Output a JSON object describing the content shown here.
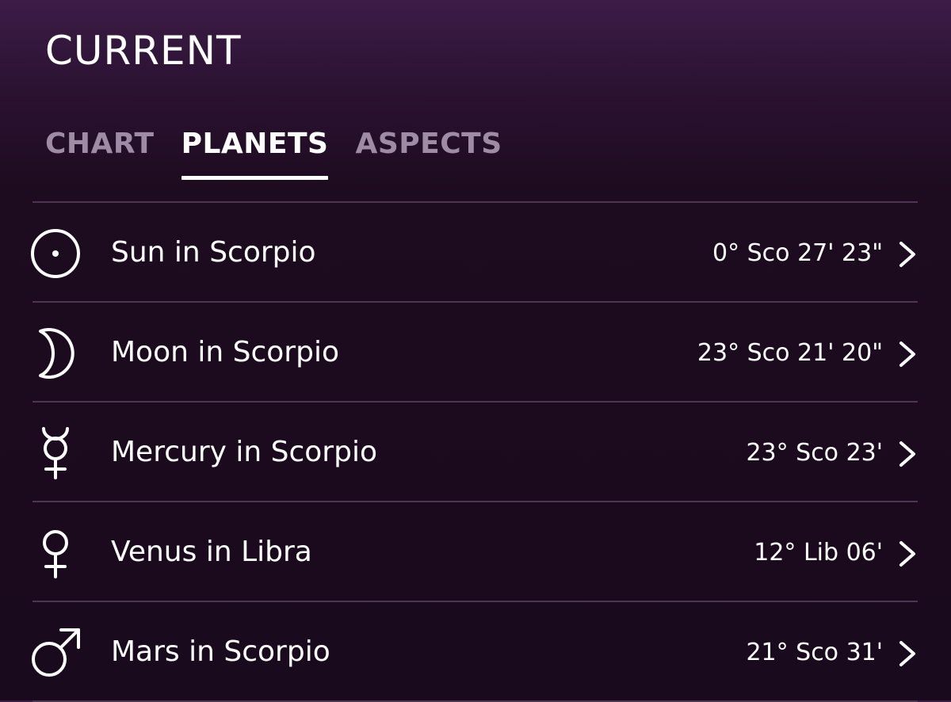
{
  "header": {
    "title": "CURRENT"
  },
  "tabs": [
    {
      "label": "CHART",
      "active": false
    },
    {
      "label": "PLANETS",
      "active": true
    },
    {
      "label": "ASPECTS",
      "active": false
    }
  ],
  "planets": [
    {
      "icon": "sun-icon",
      "label": "Sun in Scorpio",
      "position": "0° Sco 27' 23\""
    },
    {
      "icon": "moon-icon",
      "label": "Moon in Scorpio",
      "position": "23° Sco 21' 20\""
    },
    {
      "icon": "mercury-icon",
      "label": "Mercury in Scorpio",
      "position": "23° Sco 23'"
    },
    {
      "icon": "venus-icon",
      "label": "Venus in Libra",
      "position": "12° Lib 06'"
    },
    {
      "icon": "mars-icon",
      "label": "Mars in Scorpio",
      "position": "21° Sco 31'"
    }
  ],
  "colors": {
    "background_top": "#3d1c47",
    "background_bottom": "#1a0a1d",
    "inactive_tab": "#a08ba6",
    "divider": "#4c3652",
    "text": "#ffffff"
  }
}
